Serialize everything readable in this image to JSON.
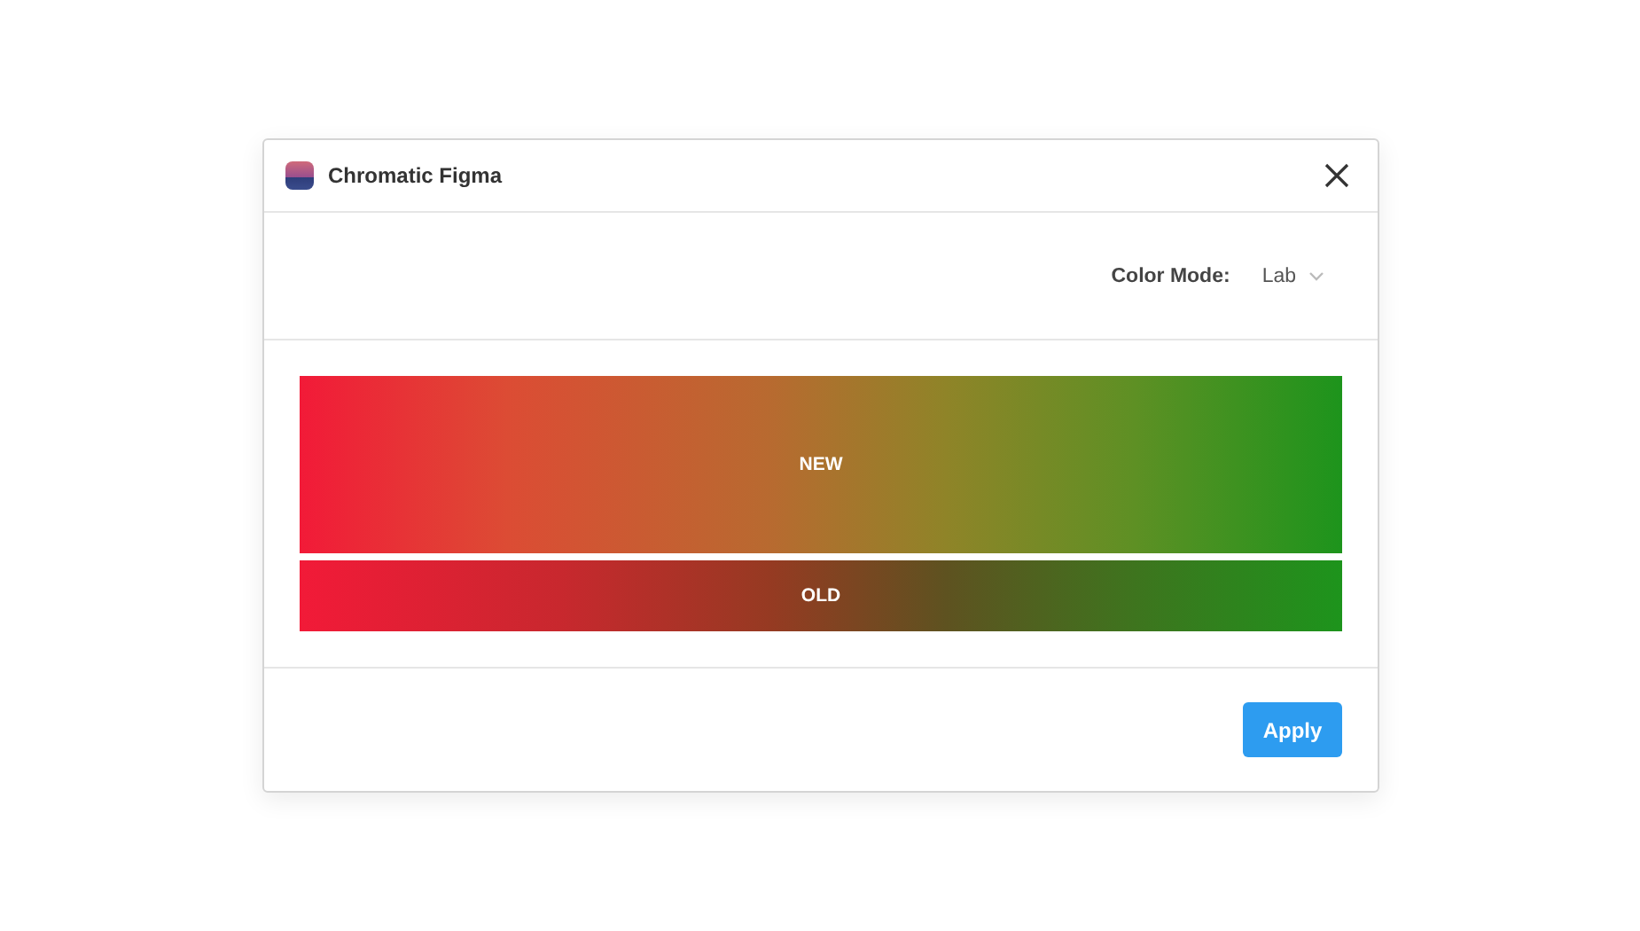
{
  "window": {
    "title": "Chromatic Figma"
  },
  "color_mode": {
    "label": "Color Mode:",
    "value": "Lab"
  },
  "swatches": [
    {
      "label": "NEW",
      "kind": "new"
    },
    {
      "label": "OLD",
      "kind": "old"
    }
  ],
  "buttons": [
    "Apply"
  ]
}
